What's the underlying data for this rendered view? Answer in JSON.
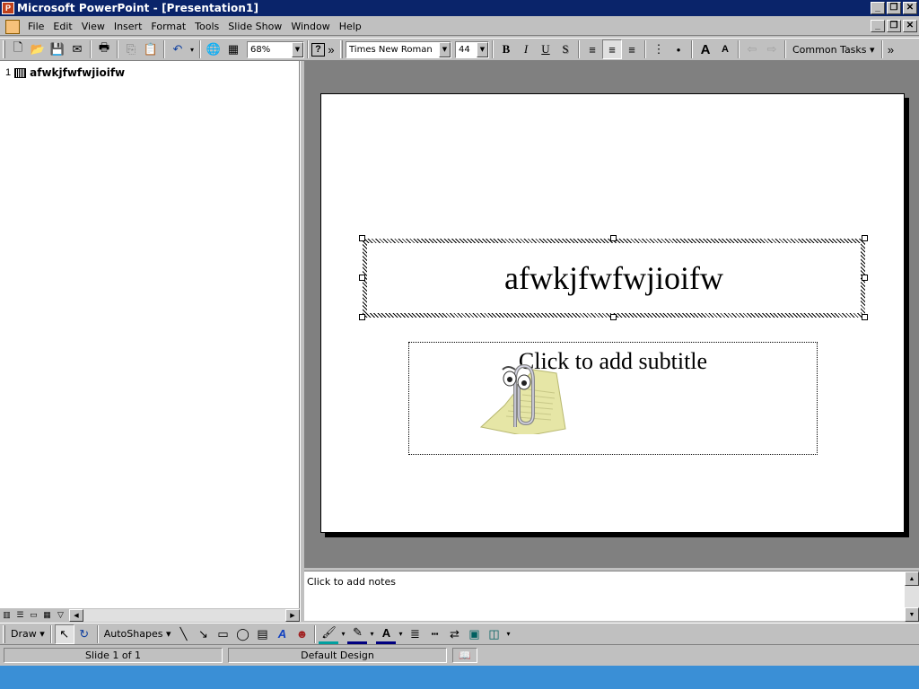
{
  "window": {
    "title": "Microsoft PowerPoint - [Presentation1]",
    "app_icon_glyph": "P",
    "buttons": [
      "_",
      "❐",
      "✕"
    ]
  },
  "menubar": {
    "items": [
      {
        "label": "File",
        "mnemonic": "F"
      },
      {
        "label": "Edit",
        "mnemonic": "E"
      },
      {
        "label": "View",
        "mnemonic": "V"
      },
      {
        "label": "Insert",
        "mnemonic": "I"
      },
      {
        "label": "Format",
        "mnemonic": "o"
      },
      {
        "label": "Tools",
        "mnemonic": "T"
      },
      {
        "label": "Slide Show",
        "mnemonic": "D"
      },
      {
        "label": "Window",
        "mnemonic": "W"
      },
      {
        "label": "Help",
        "mnemonic": "H"
      }
    ]
  },
  "toolbar": {
    "zoom": "68%",
    "font_name": "Times New Roman",
    "font_size": "44",
    "bold": "B",
    "italic": "I",
    "underline": "U",
    "shadow": "S",
    "common_tasks": "Common Tasks ▾",
    "icons": {
      "new": "🗋",
      "open": "📂",
      "save": "💾",
      "email": "✉",
      "print": "🖶",
      "copy": "⎘",
      "paste": "📋",
      "undo": "↶",
      "web": "🌐",
      "table": "▦",
      "help": "?",
      "more": "»",
      "align_left": "≡",
      "center": "≡",
      "align_right": "≡",
      "numbering": "⋮",
      "bullets": "•",
      "grow_font": "A",
      "shrink_font": "A",
      "promote": "⇦",
      "demote": "⇨"
    }
  },
  "outline": {
    "slide_number": "1",
    "slide_title": "afwkjfwfwjioifw"
  },
  "slide": {
    "title": "afwkjfwfwjioifw",
    "subtitle_placeholder": "Click to add subtitle"
  },
  "notes": {
    "placeholder": "Click to add notes"
  },
  "drawbar": {
    "draw_label": "Draw ▾",
    "autoshapes_label": "AutoShapes ▾",
    "icons": {
      "select": "↖",
      "rotate": "↻",
      "line": "╲",
      "arrow": "↘",
      "rectangle": "▭",
      "oval": "◯",
      "textbox": "▤",
      "wordart": "A",
      "clipart": "☻",
      "fill": "🖌",
      "line_color": "✎",
      "font_color": "A",
      "line_style": "≣",
      "dash_style": "┅",
      "arrow_style": "⇄",
      "shadow": "▣",
      "3d": "◫"
    }
  },
  "status": {
    "slide_info": "Slide 1 of 1",
    "design": "Default Design"
  }
}
